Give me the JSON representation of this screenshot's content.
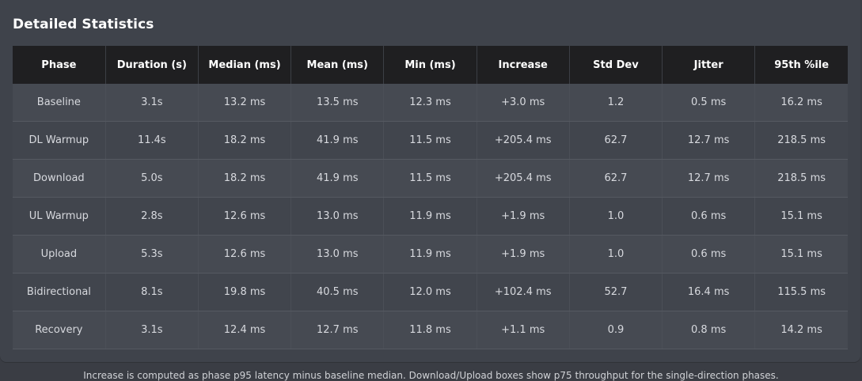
{
  "section": {
    "title": "Detailed Statistics"
  },
  "table": {
    "headers": [
      "Phase",
      "Duration (s)",
      "Median (ms)",
      "Mean (ms)",
      "Min (ms)",
      "Increase",
      "Std Dev",
      "Jitter",
      "95th %ile"
    ],
    "rows": [
      [
        "Baseline",
        "3.1s",
        "13.2 ms",
        "13.5 ms",
        "12.3 ms",
        "+3.0 ms",
        "1.2",
        "0.5 ms",
        "16.2 ms"
      ],
      [
        "DL Warmup",
        "11.4s",
        "18.2 ms",
        "41.9 ms",
        "11.5 ms",
        "+205.4 ms",
        "62.7",
        "12.7 ms",
        "218.5 ms"
      ],
      [
        "Download",
        "5.0s",
        "18.2 ms",
        "41.9 ms",
        "11.5 ms",
        "+205.4 ms",
        "62.7",
        "12.7 ms",
        "218.5 ms"
      ],
      [
        "UL Warmup",
        "2.8s",
        "12.6 ms",
        "13.0 ms",
        "11.9 ms",
        "+1.9 ms",
        "1.0",
        "0.6 ms",
        "15.1 ms"
      ],
      [
        "Upload",
        "5.3s",
        "12.6 ms",
        "13.0 ms",
        "11.9 ms",
        "+1.9 ms",
        "1.0",
        "0.6 ms",
        "15.1 ms"
      ],
      [
        "Bidirectional",
        "8.1s",
        "19.8 ms",
        "40.5 ms",
        "12.0 ms",
        "+102.4 ms",
        "52.7",
        "16.4 ms",
        "115.5 ms"
      ],
      [
        "Recovery",
        "3.1s",
        "12.4 ms",
        "12.7 ms",
        "11.8 ms",
        "+1.1 ms",
        "0.9",
        "0.8 ms",
        "14.2 ms"
      ]
    ]
  },
  "footnote": "Increase is computed as phase p95 latency minus baseline median. Download/Upload boxes show p75 throughput for the single-direction phases.",
  "colors": {
    "page_background": "#3a3d44",
    "panel_background": "#3f434b",
    "header_background": "#1f1f21",
    "row_odd": "#464a52",
    "row_even": "#41454d"
  }
}
